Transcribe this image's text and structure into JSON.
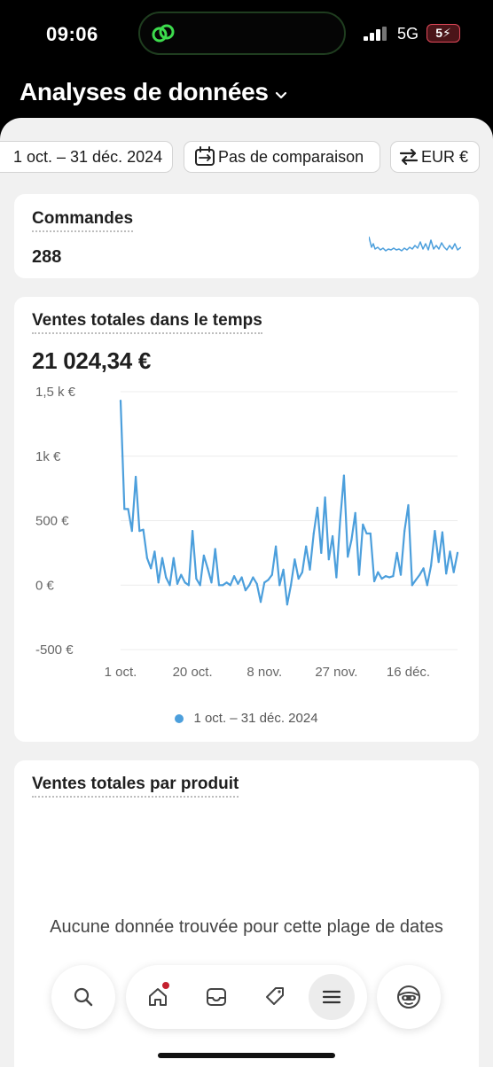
{
  "status_bar": {
    "time": "09:06",
    "network": "5G",
    "battery": "5⚡"
  },
  "header": {
    "title": "Analyses de données"
  },
  "filters": {
    "date_range": "1 oct. – 31 déc. 2024",
    "comparison": "Pas de comparaison",
    "currency": "EUR €"
  },
  "orders_card": {
    "title": "Commandes",
    "value": "288",
    "sparkline_color": "#4c9fdc"
  },
  "sales_card": {
    "title": "Ventes totales dans le temps",
    "total": "21 024,34 €",
    "legend": "1 oct. – 31 déc. 2024"
  },
  "products_card": {
    "title": "Ventes totales par produit",
    "empty_message": "Aucune donnée trouvée pour cette plage de dates"
  },
  "nav": {
    "items": [
      "search-icon",
      "home-icon",
      "inbox-icon",
      "tag-icon",
      "menu-icon",
      "avatar-icon"
    ],
    "active": "menu-icon",
    "notification_color": "#c4202e"
  },
  "chart_data": {
    "type": "line",
    "title": "Ventes totales dans le temps",
    "xlabel": "",
    "ylabel": "",
    "x_tick_labels": [
      "1 oct.",
      "20 oct.",
      "8 nov.",
      "27 nov.",
      "16 déc."
    ],
    "x_tick_indices": [
      0,
      19,
      38,
      57,
      76
    ],
    "y_tick_labels": [
      "1,5 k €",
      "1k €",
      "500 €",
      "0 €",
      "-500 €"
    ],
    "y_tick_values": [
      1500,
      1000,
      500,
      0,
      -500
    ],
    "ylim": [
      -500,
      1500
    ],
    "grid": true,
    "legend": "bottom",
    "color": "#4c9fdc",
    "series": [
      {
        "name": "1 oct. – 31 déc. 2024",
        "values": [
          1430,
          590,
          590,
          420,
          840,
          420,
          430,
          210,
          130,
          260,
          20,
          210,
          60,
          0,
          210,
          10,
          80,
          20,
          0,
          420,
          50,
          0,
          230,
          130,
          20,
          280,
          0,
          0,
          20,
          0,
          70,
          10,
          60,
          -40,
          0,
          60,
          10,
          -130,
          20,
          40,
          80,
          300,
          0,
          120,
          -150,
          0,
          200,
          50,
          100,
          300,
          120,
          400,
          600,
          250,
          680,
          200,
          380,
          60,
          500,
          850,
          220,
          350,
          560,
          80,
          470,
          400,
          400,
          30,
          100,
          50,
          70,
          60,
          70,
          250,
          80,
          420,
          620,
          0,
          40,
          80,
          130,
          0,
          150,
          420,
          180,
          410,
          90,
          260,
          100,
          250
        ]
      }
    ]
  }
}
